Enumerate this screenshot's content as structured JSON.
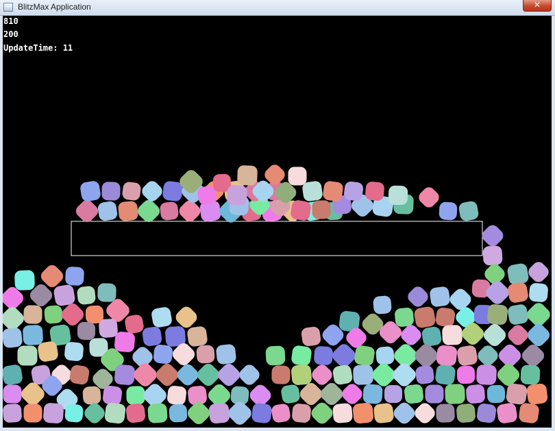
{
  "window": {
    "title": "BlitzMax Application",
    "close_glyph": "✕"
  },
  "hud": {
    "line1": "810",
    "line2": "200",
    "line3": "UpdateTime: 11"
  },
  "colors": {
    "background": "#000000",
    "platform_outline": "#ffffff"
  },
  "palette": [
    "#c8a2dc",
    "#f2906e",
    "#da8cf0",
    "#7fd07f",
    "#eb8fc9",
    "#aedcf0",
    "#ef7be8",
    "#8fae7a",
    "#9a8aa2",
    "#9fc2e8",
    "#a7d4f0",
    "#9aae7a",
    "#c97b6e",
    "#d8b49a",
    "#8ea4ee",
    "#b2dcc0",
    "#e36b8c",
    "#6bb8d8",
    "#d9a0ac",
    "#d97aa0",
    "#b2d07a",
    "#e8c28a",
    "#ef87a8",
    "#5fb0b0",
    "#f6dcdc",
    "#7ab8e0",
    "#78eaa2",
    "#b6a2e4",
    "#7b7be0",
    "#7fbcbc",
    "#78f0e6",
    "#7bd88f",
    "#cc8fe6",
    "#a58bdf",
    "#9eb59a",
    "#e58a74",
    "#b8e0d8",
    "#66c0a0",
    "#cfa9e0",
    "#9a8ad8"
  ]
}
